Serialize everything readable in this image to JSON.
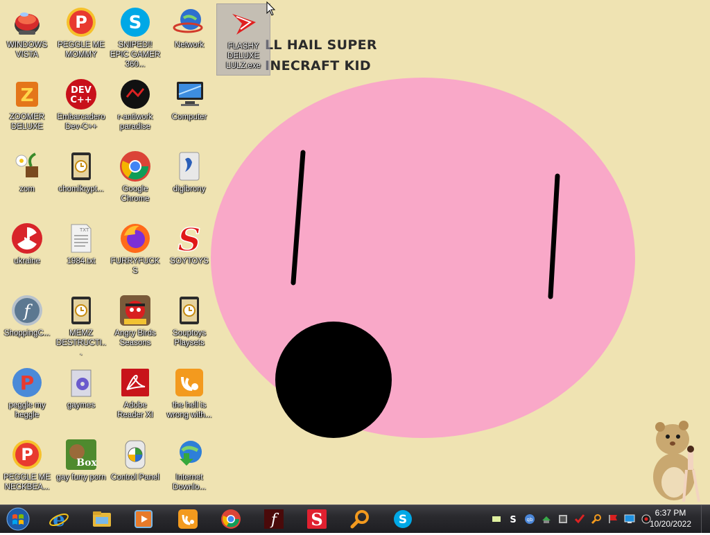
{
  "wallpaper": {
    "line1": "LL HAIL SUPER",
    "line2": "INECRAFT KID",
    "bg_color": "#efe3b2",
    "face_color": "#f9a8c8"
  },
  "icons": [
    {
      "id": "windows-vista",
      "label": "WINDOWS VISTA",
      "icon": "vista-orb-icon"
    },
    {
      "id": "peggle-me-mommy",
      "label": "PEGGLE ME MOMMY",
      "icon": "peggle-icon"
    },
    {
      "id": "sniped-epic-gamer",
      "label": "SNIPED!! EPIC GAMER 360...",
      "icon": "skype-icon"
    },
    {
      "id": "network",
      "label": "Network",
      "icon": "network-globe-icon"
    },
    {
      "id": "flashy-deluxe",
      "label": "FLASHY DELUXE LULZ.exe",
      "icon": "red-arrow-icon"
    },
    {
      "id": "zoomer-deluxe",
      "label": "ZOOMER DELUXE",
      "icon": "zoomer-icon"
    },
    {
      "id": "embarcadero-devcpp",
      "label": "Embarcadero Dev-C++",
      "icon": "devcpp-icon"
    },
    {
      "id": "r-antiwork",
      "label": "r-antiwork paradise",
      "icon": "antiwork-icon"
    },
    {
      "id": "computer",
      "label": "Computer",
      "icon": "computer-icon"
    },
    {
      "id": "zom",
      "label": "zom",
      "icon": "flower-icon"
    },
    {
      "id": "chomikrypt",
      "label": "chomikrypt...",
      "icon": "file-clock-icon"
    },
    {
      "id": "google-chrome",
      "label": "Google Chrome",
      "icon": "chrome-icon"
    },
    {
      "id": "digibrony",
      "label": "digibrony",
      "icon": "digibrony-icon"
    },
    {
      "id": "ukraine",
      "label": "ukraine",
      "icon": "radiation-icon"
    },
    {
      "id": "1984-txt",
      "label": "1984.txt",
      "icon": "text-file-icon"
    },
    {
      "id": "furryfucks",
      "label": "FURRYFUCKS",
      "icon": "firefox-icon"
    },
    {
      "id": "soytoys",
      "label": "SOYTOYS",
      "icon": "soytoys-icon"
    },
    {
      "id": "shoppingc",
      "label": "ShoppingC...",
      "icon": "flash-icon"
    },
    {
      "id": "memz-destructive",
      "label": "MEMZ DESTRUCTI...",
      "icon": "file-clock-icon"
    },
    {
      "id": "angry-birds-seasons",
      "label": "Angry Birds Seasons",
      "icon": "angry-birds-icon"
    },
    {
      "id": "souptoys-playsets",
      "label": "Souptoys Playsets",
      "icon": "file-clock-icon"
    },
    {
      "id": "peggle-my-heggle",
      "label": "peggle my heggle",
      "icon": "peggle-icon"
    },
    {
      "id": "gaymes",
      "label": "gaymes",
      "icon": "games-folder-icon"
    },
    {
      "id": "adobe-reader",
      "label": "Adobe Reader XI",
      "icon": "adobe-reader-icon"
    },
    {
      "id": "the-hell-is-wrong",
      "label": "the hell is wrong with...",
      "icon": "uc-browser-icon"
    },
    {
      "id": "peggle-me-neckbeard",
      "label": "PEGGLE ME NECKBEA...",
      "icon": "peggle-icon"
    },
    {
      "id": "gay-furry-porn",
      "label": "gay furry porn",
      "icon": "box-bear-icon"
    },
    {
      "id": "control-panel",
      "label": "Control Panel",
      "icon": "control-panel-icon"
    },
    {
      "id": "internet-download",
      "label": "Internet Downlo...",
      "icon": "idm-icon"
    }
  ],
  "taskbar": {
    "start_icon": "windows-start-icon",
    "pinned": [
      {
        "name": "internet-explorer",
        "icon": "ie-icon"
      },
      {
        "name": "file-explorer",
        "icon": "folder-icon"
      },
      {
        "name": "media-player",
        "icon": "media-player-icon"
      },
      {
        "name": "uc-browser",
        "icon": "uc-browser-icon"
      },
      {
        "name": "chrome",
        "icon": "chrome-icon"
      },
      {
        "name": "flash",
        "icon": "flash-icon"
      },
      {
        "name": "soytoys",
        "icon": "soytoys-icon"
      },
      {
        "name": "search-tool",
        "icon": "magnifier-icon"
      },
      {
        "name": "skype",
        "icon": "skype-icon"
      }
    ],
    "tray": [
      {
        "name": "tray-notes",
        "icon": "notes-icon"
      },
      {
        "name": "tray-skype",
        "icon": "skype-icon"
      },
      {
        "name": "tray-qb",
        "icon": "qb-icon"
      },
      {
        "name": "tray-network-share",
        "icon": "share-icon"
      },
      {
        "name": "tray-vm",
        "icon": "vm-icon"
      },
      {
        "name": "tray-antivirus",
        "icon": "shield-check-icon"
      },
      {
        "name": "tray-search",
        "icon": "magnifier-icon"
      },
      {
        "name": "tray-flag",
        "icon": "flag-icon"
      },
      {
        "name": "tray-monitor",
        "icon": "monitor-icon"
      },
      {
        "name": "tray-volume",
        "icon": "speaker-icon"
      }
    ],
    "clock_time": "6:37 PM",
    "clock_date": "10/20/2022"
  }
}
